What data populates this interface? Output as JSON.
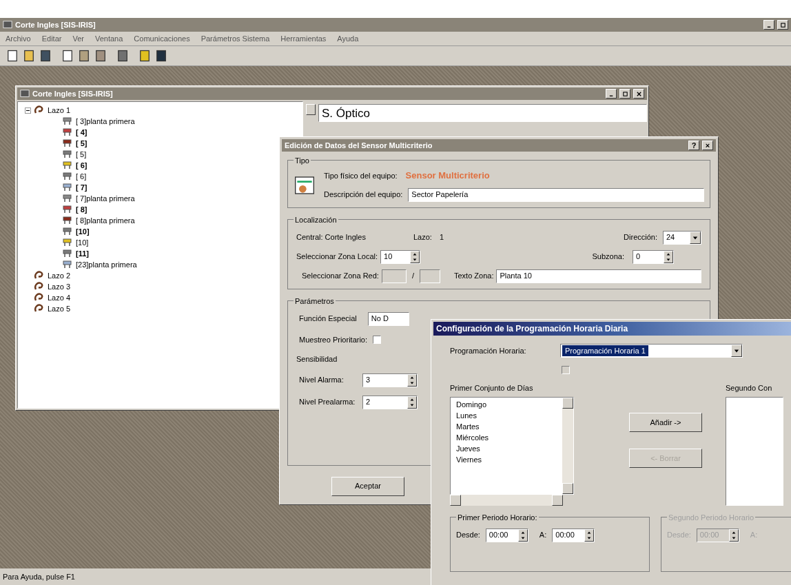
{
  "window": {
    "title": "Corte Ingles [SIS-IRIS]"
  },
  "menu": [
    "Archivo",
    "Editar",
    "Ver",
    "Ventana",
    "Comunicaciones",
    "Parámetros Sistema",
    "Herramientas",
    "Ayuda"
  ],
  "child_window": {
    "title": "Corte Ingles [SIS-IRIS]",
    "detail_text": "S. Óptico",
    "tree": [
      {
        "label": "Lazo 1",
        "expanded": true,
        "children": [
          {
            "label": "[ 3]planta primera",
            "bold": false
          },
          {
            "label": "[ 4]",
            "bold": true
          },
          {
            "label": "[ 5]",
            "bold": true
          },
          {
            "label": "[ 5]",
            "bold": false
          },
          {
            "label": "[ 6]",
            "bold": true
          },
          {
            "label": "[ 6]",
            "bold": false
          },
          {
            "label": "[ 7]",
            "bold": true
          },
          {
            "label": "[ 7]planta primera",
            "bold": false
          },
          {
            "label": "[ 8]",
            "bold": true
          },
          {
            "label": "[ 8]planta primera",
            "bold": false
          },
          {
            "label": "[10]",
            "bold": true
          },
          {
            "label": "[10]",
            "bold": false
          },
          {
            "label": "[11]",
            "bold": true
          },
          {
            "label": "[23]planta primera",
            "bold": false
          }
        ]
      },
      {
        "label": "Lazo 2",
        "expanded": false
      },
      {
        "label": "Lazo 3",
        "expanded": false
      },
      {
        "label": "Lazo 4",
        "expanded": false
      },
      {
        "label": "Lazo 5",
        "expanded": false
      }
    ]
  },
  "device_dialog": {
    "title": "Edición de Datos del Sensor Multicriterio",
    "help": "?",
    "close": "×",
    "tipo": {
      "legend": "Tipo",
      "type_label": "Tipo físico del equipo:",
      "type_value": "Sensor Multicriterio",
      "desc_label": "Descripción del equipo:",
      "desc_value": "Sector Papelería"
    },
    "localizacion": {
      "legend": "Localización",
      "central": "Central: Corte Ingles",
      "lazo_label": "Lazo:",
      "lazo_value": "1",
      "direccion_label": "Dirección:",
      "direccion_value": "24",
      "zona_local_label": "Seleccionar Zona Local:",
      "zona_local_value": "10",
      "subzona_label": "Subzona:",
      "subzona_value": "0",
      "zona_red_label": "Seleccionar Zona Red:",
      "slash": "/",
      "texto_zona_label": "Texto Zona:",
      "texto_zona_value": "Planta 10"
    },
    "parametros": {
      "legend": "Parámetros",
      "funcion_label": "Función Especial",
      "funcion_value": "No D",
      "muestreo_label": "Muestreo Prioritario:",
      "muestreo_checked": false,
      "sensibilidad": "Sensibilidad",
      "alarma_label": "Nivel Alarma:",
      "alarma_value": "3",
      "prealarma_label": "Nivel Prealarma:",
      "prealarma_value": "2"
    },
    "ok_button": "Aceptar"
  },
  "schedule_dialog": {
    "title": "Configuración de la Programación Horaria Diaria",
    "prog_label": "Programación Horaria:",
    "prog_value": "Programación Horaria 1",
    "option_checked": false,
    "first_set_label": "Primer Conjunto de Días",
    "days": [
      "Domingo",
      "Lunes",
      "Martes",
      "Miércoles",
      "Jueves",
      "Viernes"
    ],
    "add_button": {
      "label": "Añadir ->",
      "disabled": false
    },
    "remove_button": {
      "label": "<- Borrar",
      "disabled": true
    },
    "second_set_label": "Segundo Con",
    "period1": {
      "legend": "Primer Periodo Horario:",
      "disabled": false,
      "from_label": "Desde:",
      "from": "00:00",
      "to_label": "A:",
      "to": "00:00"
    },
    "period2": {
      "legend": "Segundo Periodo Horario",
      "disabled": true,
      "from_label": "Desde:",
      "from": "00:00",
      "to_label": "A:"
    }
  },
  "status_bar": "Para Ayuda, pulse F1"
}
